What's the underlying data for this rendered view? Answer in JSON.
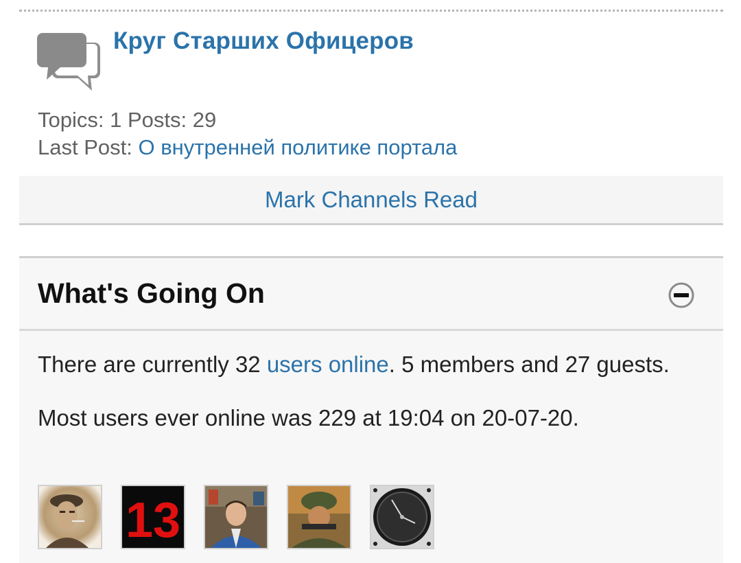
{
  "channel": {
    "title": "Круг Старших Офицеров",
    "topics_label": "Topics:",
    "topics_count": "1",
    "posts_label": "Posts:",
    "posts_count": "29",
    "last_post_label": "Last Post:",
    "last_post_title": "О внутренней политике портала",
    "icon": "speech-bubbles-icon"
  },
  "mark_read": {
    "label": "Mark Channels Read"
  },
  "whats_going_on": {
    "title": "What's Going On",
    "collapse_icon": "minus-circle-icon",
    "online_prefix": "There are currently 32 ",
    "online_link": "users online",
    "online_suffix": ". 5 members and 27 guests.",
    "record_text": "Most users ever online was 229 at 19:04 on 20-07-20.",
    "avatars": [
      {
        "name": "avatar-officer-portrait"
      },
      {
        "name": "avatar-number-13",
        "text": "13"
      },
      {
        "name": "avatar-man-photo"
      },
      {
        "name": "avatar-soldier-painting"
      },
      {
        "name": "avatar-speed-gauge"
      }
    ]
  },
  "colors": {
    "link": "#2b73aa",
    "panel_bg": "#f7f7f7",
    "border": "#cfcfcf",
    "icon_gray": "#8a8a8a"
  }
}
